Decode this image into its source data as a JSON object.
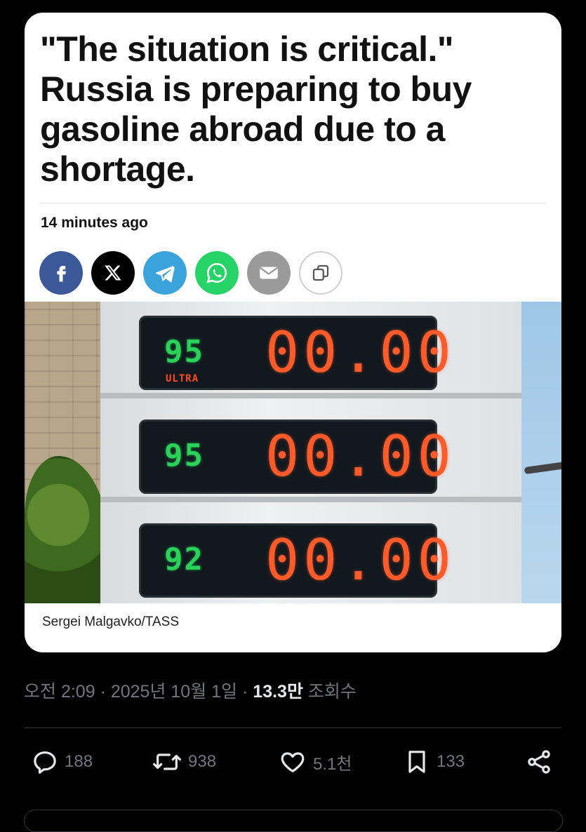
{
  "article": {
    "headline": "\"The situation is critical.\" Russia is preparing to buy gasoline abroad due to a shortage.",
    "time_ago": "14 minutes ago",
    "share_buttons": [
      "facebook-icon",
      "x-icon",
      "telegram-icon",
      "whatsapp-icon",
      "email-icon",
      "copy-icon"
    ],
    "photo": {
      "rows": [
        {
          "grade": "95",
          "sublabel": "ULTRA",
          "price": "00.00"
        },
        {
          "grade": "95",
          "sublabel": "",
          "price": "00.00"
        },
        {
          "grade": "92",
          "sublabel": "",
          "price": "00.00"
        }
      ]
    },
    "photo_credit": "Sergei Malgavko/TASS"
  },
  "post_meta": {
    "time": "오전 2:09",
    "date": "2025년 10월 1일",
    "views_count": "13.3만",
    "views_label": "조회수",
    "separator": "·"
  },
  "actions": {
    "replies": "188",
    "reposts": "938",
    "likes": "5.1천",
    "bookmarks": "133"
  },
  "colors": {
    "background": "#000000",
    "muted": "#71767b",
    "facebook": "#3b5998",
    "telegram": "#3aa3dc",
    "whatsapp": "#25d366",
    "led_green": "#29d35a",
    "led_orange": "#ff5a2a"
  }
}
